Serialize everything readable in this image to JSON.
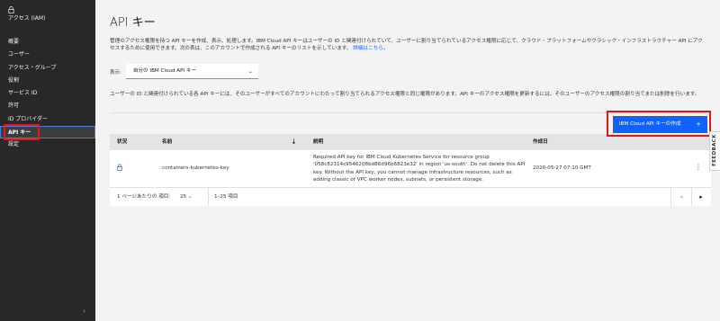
{
  "sidebar": {
    "title": "アクセス (IAM)",
    "items": [
      {
        "label": "概要"
      },
      {
        "label": "ユーザー"
      },
      {
        "label": "アクセス・グループ"
      },
      {
        "label": "役割"
      },
      {
        "label": "サービス ID"
      },
      {
        "label": "許可"
      },
      {
        "label": "ID プロバイダー"
      },
      {
        "label": "API キー"
      },
      {
        "label": "設定"
      }
    ],
    "collapse_icon": "chevron-left-icon"
  },
  "main": {
    "title": "API キー",
    "description": "管理のアクセス権限を持つ API キーを作成、表示、処理します。IBM Cloud API キーはユーザーの ID と関連付けられていて、ユーザーに割り当てられているアクセス権限に応じて、クラウド・プラットフォームやクラシック・インフラストラクチャー API にアクセスするために使用できます。次の表は、このアカウントで作成される API キーのリストを示しています。",
    "description_link": "詳細はこちら。",
    "show_label": "表示:",
    "show_select": "自分の IBM Cloud API キー",
    "info": "ユーザーの ID と関連付けられている各 API キーには、そのユーザーがすべてのアカウントにわたって割り当てられるアクセス権限と同じ権限があります。API キーのアクセス権限を更新するには、そのユーザーのアクセス権限の割り当てまたは削除を行います。",
    "create_button": "IBM Cloud API キーの作成",
    "table": {
      "headers": {
        "status": "状況",
        "name": "名前",
        "description": "説明",
        "created": "作成日"
      },
      "rows": [
        {
          "name": "containers-kubernetes-key",
          "description": "Required API key for IBM Cloud Kubernetes Service for resource group '058c82314c9546208bd86d96b6823e32' in region 'us-south'. Do not delete this API key. Without the API key, you cannot manage infrastructure resources, such as adding classic or VPC worker nodes, subnets, or persistent storage.",
          "created": "2020-05-27 07:10 GMT"
        }
      ]
    },
    "pagination": {
      "per_page_label": "1 ページあたりの 項目:",
      "per_page_value": "25",
      "range": "1–25 項目"
    }
  },
  "feedback_label": "FEEDBACK",
  "colors": {
    "accent": "#0f62fe",
    "highlight": "#e0161e",
    "sidebar_bg": "#282828"
  }
}
